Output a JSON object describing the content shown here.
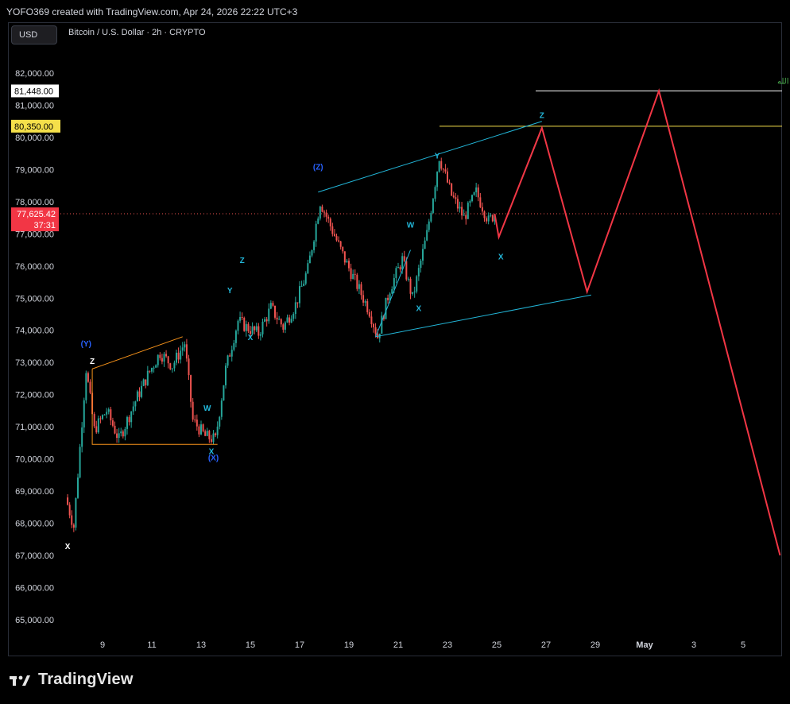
{
  "header": {
    "credit": "YOFO369 created with TradingView.com, Apr 24, 2026 22:22 UTC+3",
    "currency": "USD",
    "symbol": "Bitcoin / U.S. Dollar · 2h · CRYPTO"
  },
  "footer": {
    "brand": "TradingView"
  },
  "colors": {
    "background": "#000000",
    "up": "#26a69a",
    "down": "#ef5350",
    "projection": "#f23645",
    "channel": "#22b6d8",
    "orange": "#f7931a",
    "level_white": "#ffffff",
    "level_yellow": "#f5e04a",
    "annotation_green": "#4caf50"
  },
  "chart_data": {
    "type": "candlestick",
    "title": "Bitcoin / U.S. Dollar · 2h · CRYPTO",
    "xlabel": "",
    "ylabel": "",
    "x_ticks": [
      "9",
      "11",
      "13",
      "15",
      "17",
      "19",
      "21",
      "23",
      "25",
      "27",
      "29",
      "May",
      "3",
      "5"
    ],
    "y_ticks": [
      "65,000.00",
      "66,000.00",
      "67,000.00",
      "68,000.00",
      "69,000.00",
      "70,000.00",
      "71,000.00",
      "72,000.00",
      "73,000.00",
      "74,000.00",
      "75,000.00",
      "76,000.00",
      "77,000.00",
      "78,000.00",
      "79,000.00",
      "80,000.00",
      "81,000.00",
      "82,000.00"
    ],
    "ylim": [
      64600,
      82600
    ],
    "grid": false,
    "last_price": {
      "label": "77,625.42",
      "countdown": "37:31",
      "value": 77625.42
    },
    "levels": [
      {
        "label": "81,448.00",
        "value": 81448,
        "color": "white",
        "annotation": "مستوى الانعكاس الرئيسي بإذن الله"
      },
      {
        "label": "80,350.00",
        "value": 80350,
        "color": "yellow"
      }
    ],
    "price_path": [
      [
        "Apr 7 12:00",
        68800
      ],
      [
        "Apr 7 20:00",
        67900
      ],
      [
        "Apr 8 08:00",
        72800
      ],
      [
        "Apr 8 16:00",
        70900
      ],
      [
        "Apr 9 04:00",
        71500
      ],
      [
        "Apr 9 16:00",
        70600
      ],
      [
        "Apr 10 08:00",
        71800
      ],
      [
        "Apr 10 20:00",
        72600
      ],
      [
        "Apr 11 08:00",
        73300
      ],
      [
        "Apr 11 20:00",
        72900
      ],
      [
        "Apr 12 08:00",
        73600
      ],
      [
        "Apr 12 16:00",
        71200
      ],
      [
        "Apr 13 04:00",
        70700
      ],
      [
        "Apr 13 14:00",
        70600
      ],
      [
        "Apr 14 00:00",
        72800
      ],
      [
        "Apr 14 12:00",
        74300
      ],
      [
        "Apr 14 20:00",
        74100
      ],
      [
        "Apr 15 08:00",
        73900
      ],
      [
        "Apr 15 20:00",
        74700
      ],
      [
        "Apr 16 08:00",
        74100
      ],
      [
        "Apr 16 20:00",
        74800
      ],
      [
        "Apr 17 08:00",
        75900
      ],
      [
        "Apr 17 20:00",
        78000
      ],
      [
        "Apr 18 08:00",
        77100
      ],
      [
        "Apr 18 20:00",
        76200
      ],
      [
        "Apr 19 08:00",
        75400
      ],
      [
        "Apr 19 20:00",
        74600
      ],
      [
        "Apr 20 04:00",
        73800
      ],
      [
        "Apr 20 16:00",
        75300
      ],
      [
        "Apr 21 04:00",
        76200
      ],
      [
        "Apr 21 14:00",
        75000
      ],
      [
        "Apr 22 04:00",
        77000
      ],
      [
        "Apr 22 16:00",
        79400
      ],
      [
        "Apr 23 04:00",
        78200
      ],
      [
        "Apr 23 16:00",
        77500
      ],
      [
        "Apr 24 04:00",
        78300
      ],
      [
        "Apr 24 16:00",
        77400
      ],
      [
        "Apr 24 22:00",
        77625
      ]
    ],
    "projection": [
      [
        "Apr 24 22:00",
        77625
      ],
      [
        "Apr 25 02:00",
        76900
      ],
      [
        "Apr 26 20:00",
        80300
      ],
      [
        "Apr 28 16:00",
        75200
      ],
      [
        "May 1 14:00",
        81450
      ],
      [
        "May 6 12:00",
        67000
      ]
    ],
    "wave_labels": [
      {
        "label": "X",
        "x": "Apr 7 14:00",
        "y": 67200,
        "color": "white"
      },
      {
        "label": "(Y)",
        "x": "Apr 8 08:00",
        "y": 73500,
        "color": "blue"
      },
      {
        "label": "Z",
        "x": "Apr 8 14:00",
        "y": 72950,
        "color": "white"
      },
      {
        "label": "W",
        "x": "Apr 13 06:00",
        "y": 71500,
        "color": "cyan"
      },
      {
        "label": "X",
        "x": "Apr 13 10:00",
        "y": 70150,
        "color": "cyan"
      },
      {
        "label": "(X)",
        "x": "Apr 13 12:00",
        "y": 69950,
        "color": "blue"
      },
      {
        "label": "Y",
        "x": "Apr 14 04:00",
        "y": 75150,
        "color": "cyan"
      },
      {
        "label": "Z",
        "x": "Apr 14 16:00",
        "y": 76100,
        "color": "cyan"
      },
      {
        "label": "X",
        "x": "Apr 15 00:00",
        "y": 73700,
        "color": "cyan"
      },
      {
        "label": "(Z)",
        "x": "Apr 17 18:00",
        "y": 79000,
        "color": "blue"
      },
      {
        "label": "W",
        "x": "Apr 21 12:00",
        "y": 77200,
        "color": "cyan"
      },
      {
        "label": "X",
        "x": "Apr 21 20:00",
        "y": 74600,
        "color": "cyan"
      },
      {
        "label": "Y",
        "x": "Apr 22 14:00",
        "y": 79350,
        "color": "cyan"
      },
      {
        "label": "X",
        "x": "Apr 25 04:00",
        "y": 76200,
        "color": "cyan"
      },
      {
        "label": "Z",
        "x": "Apr 26 20:00",
        "y": 80600,
        "color": "cyan"
      }
    ]
  }
}
